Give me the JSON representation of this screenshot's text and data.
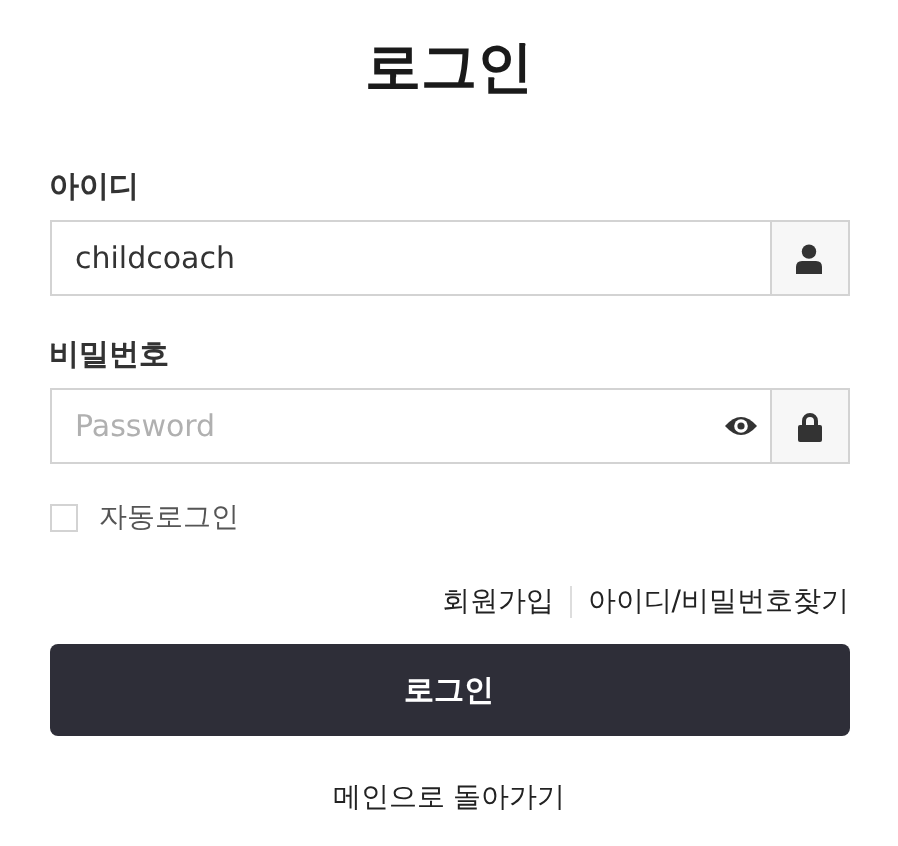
{
  "title": "로그인",
  "fields": [
    {
      "kind": "id",
      "label": "아이디",
      "value": "childcoach"
    },
    {
      "kind": "password",
      "label": "비밀번호",
      "placeholder": "Password"
    }
  ],
  "auto_login": {
    "label": "자동로그인",
    "checked": false
  },
  "links": [
    "회원가입",
    "아이디/비밀번호찾기"
  ],
  "submit": "로그인",
  "back_link": "메인으로 돌아가기"
}
